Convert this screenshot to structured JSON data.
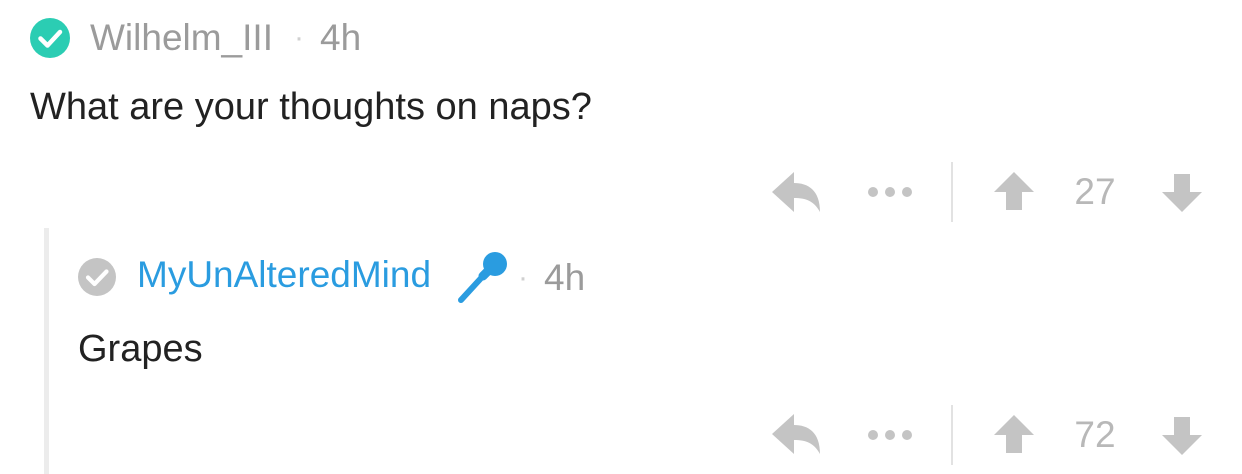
{
  "colors": {
    "verified": "#2bcdb3",
    "author_link": "#2a9ce0",
    "meta": "#9b9b9b",
    "icon_gray": "#c4c4c4"
  },
  "comment": {
    "author": "Wilhelm_III",
    "separator": "·",
    "time": "4h",
    "body": "What are your thoughts on naps?",
    "score": "27",
    "badge_icon": "verified-check-icon"
  },
  "reply": {
    "author": "MyUnAlteredMind",
    "flair_icon": "microphone-icon",
    "separator": "·",
    "time": "4h",
    "body": "Grapes",
    "score": "72",
    "badge_icon": "check-circle-icon"
  },
  "actions": {
    "reply_icon": "reply-arrow-icon",
    "more_icon": "more-options-icon",
    "upvote_icon": "upvote-arrow-icon",
    "downvote_icon": "downvote-arrow-icon"
  }
}
